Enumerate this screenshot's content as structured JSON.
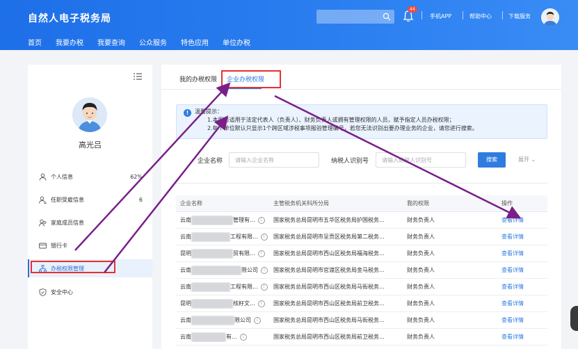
{
  "header": {
    "title": "自然人电子税务局",
    "notification_count": "44",
    "links": [
      "手机APP",
      "帮助中心",
      "下载服务"
    ],
    "nav": [
      "首页",
      "我要办税",
      "我要查询",
      "公众服务",
      "特色应用",
      "单位办税"
    ]
  },
  "sidebar": {
    "user_name": "高光吕",
    "items": [
      {
        "label": "个人信息",
        "value": "62%"
      },
      {
        "label": "任职受雇信息",
        "value": "6"
      },
      {
        "label": "家庭成员信息",
        "value": ""
      },
      {
        "label": "银行卡",
        "value": ""
      },
      {
        "label": "办税权限管理",
        "value": ""
      },
      {
        "label": "安全中心",
        "value": ""
      }
    ]
  },
  "main": {
    "tabs": [
      "我的办税权限",
      "企业办税权限"
    ],
    "tip": {
      "title": "温馨提示：",
      "line1": "1.本服务适用于法定代表人（负责人）、财务负责人或拥有管理权限的人员，赋予指定人员办税权限；",
      "line2": "2.每个单位默认只显示1个跨区域涉税事项报验管理编号，若您无法识别出要办理业务的企业，请您进行搜索。"
    },
    "search": {
      "company_label": "企业名称",
      "company_placeholder": "请输入企业名称",
      "tax_id_label": "纳税人识别号",
      "tax_id_placeholder": "请输入纳税人识别号",
      "search_button": "搜索",
      "expand": "展开"
    },
    "table": {
      "headers": [
        "企业名称",
        "主管税务机关科所分局",
        "我的权限",
        "操作"
      ],
      "rows": [
        {
          "name_pre": "云南",
          "name_post": "管理有...",
          "bureau": "国家税务总局昆明市五华区税务局护国税务...",
          "permission": "财务负责人",
          "action": "查看详情"
        },
        {
          "name_pre": "云南",
          "name_post": "工程有限...",
          "bureau": "国家税务总局昆明市呈贡区税务局第二税务...",
          "permission": "财务负责人",
          "action": "查看详情"
        },
        {
          "name_pre": "昆明",
          "name_post": "贸有限...",
          "bureau": "国家税务总局昆明市西山区税务局福海税务...",
          "permission": "财务负责人",
          "action": "查看详情"
        },
        {
          "name_pre": "云南",
          "name_post": "限公司",
          "bureau": "国家税务总局昆明市官渡区税务局金马税务...",
          "permission": "财务负责人",
          "action": "查看详情"
        },
        {
          "name_pre": "云南",
          "name_post": "工程有限...",
          "bureau": "国家税务总局昆明市西山区税务局马街税务...",
          "permission": "财务负责人",
          "action": "查看详情"
        },
        {
          "name_pre": "昆明",
          "name_post": "核籽文...",
          "bureau": "国家税务总局昆明市西山区税务局前卫税务...",
          "permission": "财务负责人",
          "action": "查看详情"
        },
        {
          "name_pre": "云南",
          "name_post": "限公司",
          "bureau": "国家税务总局昆明市西山区税务局马街税务...",
          "permission": "财务负责人",
          "action": "查看详情"
        },
        {
          "name_pre": "云南",
          "name_post": "有...",
          "bureau": "国家税务总局昆明市西山区税务局前卫税务...",
          "permission": "财务负责人",
          "action": "查看详情"
        }
      ]
    }
  },
  "colors": {
    "brand_blue": "#1e6fe8",
    "link_blue": "#2f7ce0",
    "annotation_red": "#e53030",
    "annotation_arrow": "#7a1f8a"
  }
}
